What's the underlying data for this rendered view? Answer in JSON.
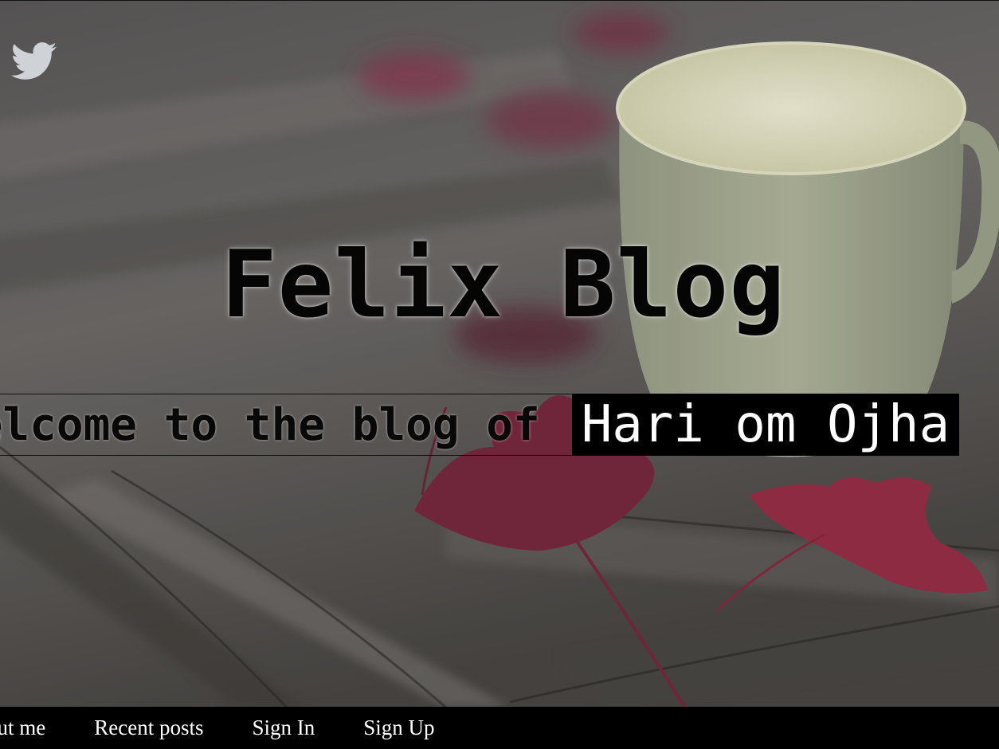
{
  "header": {
    "title": "Felix Blog",
    "welcome_text": "Welcome to the blog of",
    "author_name": "Hari om Ojha"
  },
  "social": {
    "icon": "twitter-icon",
    "icon_color": "#cfd3d8"
  },
  "nav": {
    "items": [
      {
        "label": "About me"
      },
      {
        "label": "Recent posts"
      },
      {
        "label": "Sign In"
      },
      {
        "label": "Sign Up"
      }
    ]
  },
  "colors": {
    "nav_background": "#000000",
    "nav_text": "#ffffff",
    "name_highlight_bg": "#000000",
    "name_highlight_text": "#ffffff"
  }
}
